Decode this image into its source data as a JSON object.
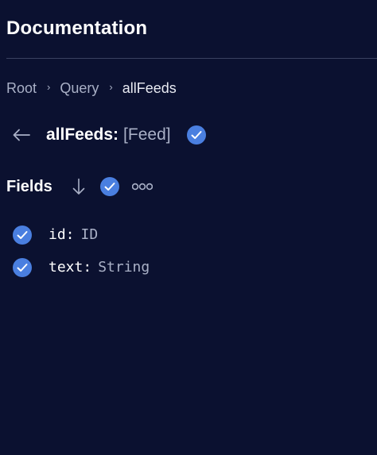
{
  "header": {
    "title": "Documentation"
  },
  "breadcrumb": {
    "items": [
      "Root",
      "Query",
      "allFeeds"
    ],
    "separator": "›"
  },
  "type_title": {
    "name": "allFeeds:",
    "signature": "[Feed]",
    "back_icon": "arrow-left-icon",
    "status_icon": "check-circle-icon"
  },
  "fields_section": {
    "label": "Fields",
    "sort_icon": "arrow-down-icon",
    "select_icon": "check-circle-icon",
    "more_icon": "more-dots-icon"
  },
  "fields": [
    {
      "name": "id:",
      "type": "ID"
    },
    {
      "name": "text:",
      "type": "String"
    }
  ],
  "colors": {
    "background": "#0b1130",
    "accent": "#4a7fe0",
    "muted_text": "#a9b0c6",
    "divider": "#3a4160"
  }
}
